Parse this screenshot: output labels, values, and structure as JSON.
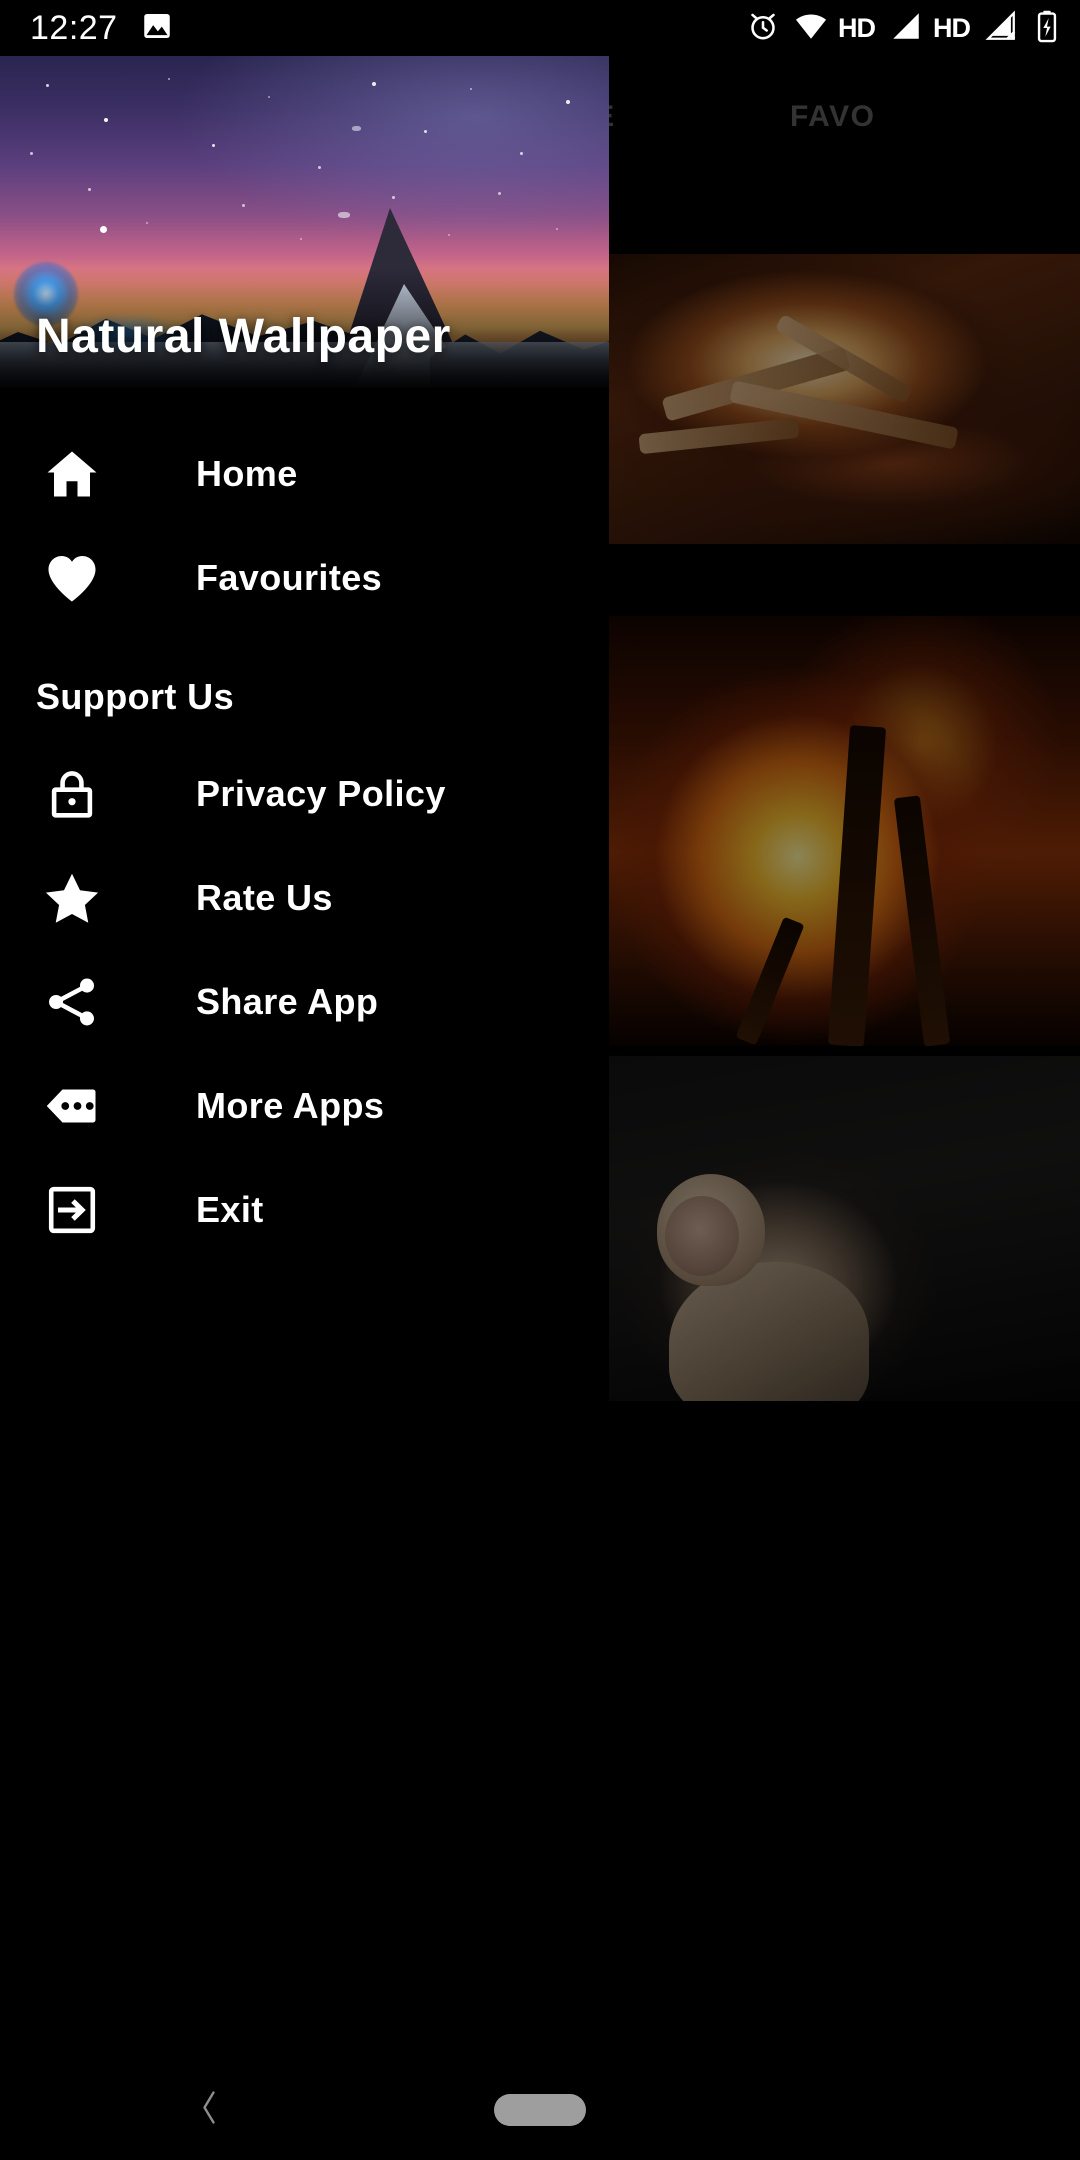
{
  "status_bar": {
    "time": "12:27",
    "left_icons": [
      "image-icon"
    ],
    "right_icons": [
      "alarm-icon",
      "wifi-icon",
      "hd-wifi-label",
      "signal-bars-icon",
      "hd-signal-label",
      "signal-off-icon",
      "battery-charging-icon"
    ],
    "hd_label_1": "HD",
    "hd_label_2": "HD"
  },
  "background": {
    "tabs": [
      {
        "label": "TURE",
        "name": "tab-nature"
      },
      {
        "label": "FAVO",
        "name": "tab-favourite"
      }
    ],
    "thumbnails": [
      {
        "name": "thumbnail-campfire",
        "alt": "campfire with burning logs"
      },
      {
        "name": "thumbnail-flames",
        "alt": "tall orange flames with logs"
      },
      {
        "name": "thumbnail-monkey",
        "alt": "macaque monkey sitting on rock"
      }
    ]
  },
  "drawer": {
    "title": "Natural Wallpaper",
    "header_image_alt": "starry night sky over snowy mountain peak",
    "primary_items": [
      {
        "label": "Home",
        "icon": "home-icon"
      },
      {
        "label": "Favourites",
        "icon": "heart-icon"
      }
    ],
    "section_title": "Support Us",
    "support_items": [
      {
        "label": "Privacy Policy",
        "icon": "lock-icon"
      },
      {
        "label": "Rate Us",
        "icon": "star-icon"
      },
      {
        "label": "Share App",
        "icon": "share-icon"
      },
      {
        "label": "More Apps",
        "icon": "more-apps-icon"
      },
      {
        "label": "Exit",
        "icon": "exit-icon"
      }
    ]
  },
  "navigation_bar": {
    "back": "back-chevron-icon",
    "home": "home-pill-icon"
  },
  "colors": {
    "background": "#000000",
    "text": "#ffffff",
    "tab_inactive": "#5e5e5e",
    "nav_pill": "#9e9e9e"
  }
}
